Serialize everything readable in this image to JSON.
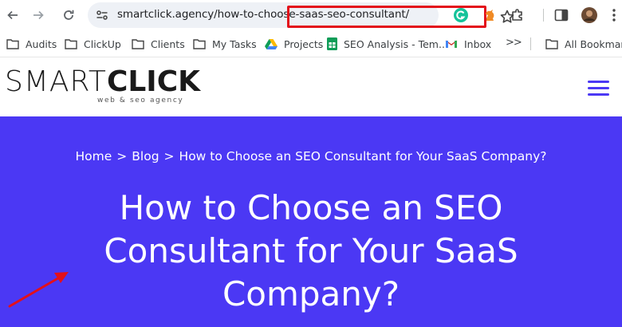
{
  "browser": {
    "url_host": "smartclick.agency",
    "url_path": "/how-to-choose-saas-seo-consultant/",
    "colors": {
      "highlight": "#e3101b",
      "arrow": "#e3101b"
    }
  },
  "bookmarks": [
    {
      "label": "Audits",
      "icon": "folder-icon"
    },
    {
      "label": "ClickUp",
      "icon": "folder-icon"
    },
    {
      "label": "Clients",
      "icon": "folder-icon"
    },
    {
      "label": "My Tasks",
      "icon": "folder-icon"
    },
    {
      "label": "Projects",
      "icon": "google-drive-icon"
    },
    {
      "label": "SEO Analysis - Tem...",
      "icon": "google-sheets-icon"
    },
    {
      "label": "Inbox",
      "icon": "gmail-icon"
    }
  ],
  "bookmarks_more": ">>",
  "all_bookmarks": "All Bookmarks",
  "site": {
    "logo_light": "SMART",
    "logo_bold": "CLICK",
    "logo_tagline": "web & seo agency",
    "colors": {
      "brand": "#4b38f4"
    }
  },
  "hero": {
    "breadcrumb": [
      "Home",
      "Blog",
      "How to Choose an SEO Consultant for Your SaaS Company?"
    ],
    "breadcrumb_sep": ">",
    "title_lines": [
      "How to Choose an SEO",
      "Consultant for Your SaaS",
      "Company?"
    ]
  }
}
